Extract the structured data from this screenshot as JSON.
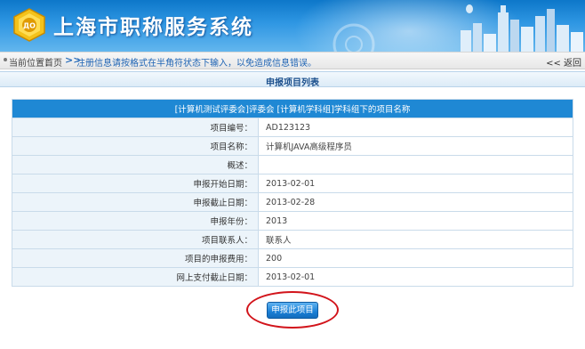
{
  "header": {
    "site_title": "上海市职称服务系统"
  },
  "breadcrumb": {
    "label": "当前位置：",
    "home": "首页",
    "separator": ">>",
    "note": "注册信息请按格式在半角符状态下输入，以免造成信息错误。",
    "back": "<< 返回"
  },
  "section": {
    "title": "申报项目列表"
  },
  "table": {
    "header": "[计算机测试评委会]评委会 [计算机学科组]学科组下的项目名称",
    "rows": [
      {
        "label": "项目编号：",
        "value": "AD123123"
      },
      {
        "label": "项目名称：",
        "value": "计算机JAVA高级程序员"
      },
      {
        "label": "概述：",
        "value": ""
      },
      {
        "label": "申报开始日期：",
        "value": "2013-02-01"
      },
      {
        "label": "申报截止日期：",
        "value": "2013-02-28"
      },
      {
        "label": "申报年份：",
        "value": "2013"
      },
      {
        "label": "项目联系人：",
        "value": "联系人"
      },
      {
        "label": "项目的申报费用：",
        "value": "200"
      },
      {
        "label": "网上支付截止日期：",
        "value": "2013-02-01"
      }
    ]
  },
  "actions": {
    "submit_label": "申报此项目"
  },
  "colors": {
    "header_blue": "#1f88d4",
    "annotation_red": "#d2141b"
  },
  "icons": {
    "logo": "emblem-logo",
    "skyline": "city-skyline-graphic"
  }
}
